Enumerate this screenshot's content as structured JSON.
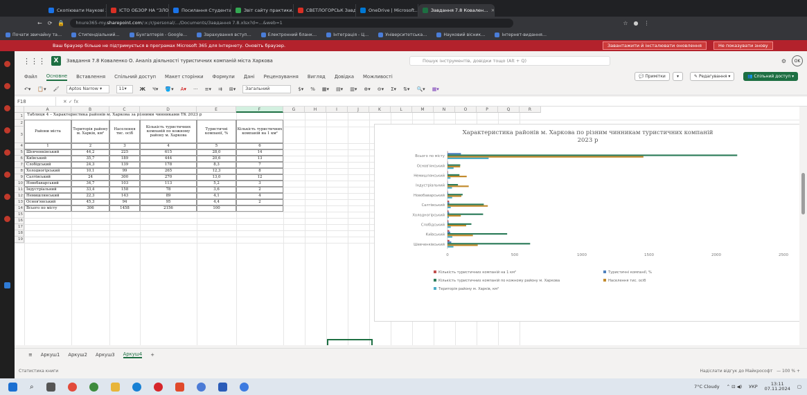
{
  "browser": {
    "tabs": [
      "Скопіювати Наукові 2…",
      "ІСТО ОБЗОР НА “ЗЛО…",
      "Посилання Студента",
      "Звіт сайту практики…",
      "СВЕТЛОГОРСЬК Завдання…",
      "OneDrive | Microsoft…",
      "Завдання 7.8 Ковален…"
    ],
    "url_prefix": "hnure365-my.",
    "url_host": "sharepoint.com",
    "url_rest": "/:x:/r/personal/.../Documents/Завдання 7.8.xlsx?d=...&web=1",
    "bookmarks": [
      "Почати звичайну та…",
      "Стипендіальний…",
      "Бухгалтерія - Google…",
      "Зарахування вступ…",
      "Електронний бланк…",
      "Інтеграція - Ц…",
      "Університетська…",
      "Науковий вісник…",
      "Інтернет-видання…"
    ],
    "banner_text": "Ваш браузер більше не підтримується в програмах Microsoft 365 для Інтернету. Оновіть браузер.",
    "banner_btn1": "Завантажити й інсталювати оновлення",
    "banner_btn2": "Не показувати знову"
  },
  "excel": {
    "file_title": "Завдання 7.8 Коваленко О. Аналіз діяльності туристичних компаній міста Харкова",
    "search_placeholder": "Пошук інструментів, довідки тощо (Alt + Q)",
    "ribbon_tabs": [
      "Файл",
      "Основне",
      "Вставлення",
      "Спільний доступ",
      "Макет сторінки",
      "Формули",
      "Дані",
      "Рецензування",
      "Вигляд",
      "Довідка",
      "Можливості"
    ],
    "ribbon_active": "Основне",
    "comments_btn": "Примітки",
    "editing_btn": "Редагування",
    "share_btn": "Спільний доступ",
    "font_name": "Aptos Narrow",
    "font_size": "11",
    "number_format": "Загальний",
    "name_box": "F18",
    "sheet_tabs": [
      "Аркуш1",
      "Аркуш2",
      "Аркуш3",
      "Аркуш4"
    ],
    "active_sheet": "Аркуш4",
    "add_sheet": "+",
    "status_left": "Статистика книги",
    "status_right": "Надіслати відгук до Майкрософт",
    "zoom": "100 %"
  },
  "columns": [
    "A",
    "B",
    "C",
    "D",
    "E",
    "F",
    "G",
    "H",
    "I",
    "J",
    "K",
    "L",
    "M",
    "N",
    "O",
    "P",
    "Q",
    "R"
  ],
  "row_numbers": [
    "1",
    "2",
    "3",
    "4",
    "5",
    "6",
    "7",
    "8",
    "9",
    "10",
    "11",
    "12",
    "13",
    "14",
    "15",
    "16",
    "17",
    "18",
    "19"
  ],
  "table": {
    "title": "Таблиця 4 – Характеристика районів м. Харкова за різними чинниками ТК 2023 р",
    "headers": [
      "Райони міста",
      "Територія району м. Харків, км²",
      "Населення тис. осіб",
      "Кількість туристичних компаній по кожному району м. Харкова",
      "Туристичні компанії, %",
      "Кількість туристичних компаній на 1 км²"
    ],
    "index_row": [
      "1",
      "2",
      "3",
      "4",
      "5",
      "6"
    ],
    "rows": [
      [
        "Шевченківський",
        "44,2",
        "225",
        "615",
        "28,0",
        "14"
      ],
      [
        "Київський",
        "35,7",
        "189",
        "444",
        "20,6",
        "13"
      ],
      [
        "Слобідський",
        "24,3",
        "139",
        "178",
        "8,3",
        "7"
      ],
      [
        "Холодногірський",
        "10,1",
        "99",
        "265",
        "12,3",
        "8"
      ],
      [
        "Салтівський",
        "24",
        "300",
        "270",
        "13,0",
        "12"
      ],
      [
        "Новобаварський",
        "34,7",
        "103",
        "113",
        "5,2",
        "3"
      ],
      [
        "Індустріальний",
        "33,4",
        "158",
        "78",
        "3,6",
        "2"
      ],
      [
        "Немишлянський",
        "22,3",
        "143",
        "89",
        "4,1",
        "4"
      ],
      [
        "Основ'янський",
        "45,3",
        "94",
        "95",
        "4,4",
        "2"
      ],
      [
        "Всього по місту",
        "306",
        "1458",
        "2156",
        "100",
        ""
      ]
    ]
  },
  "chart_data": {
    "type": "bar",
    "orientation": "horizontal",
    "title": "Характеристика районів м. Харкова по різним чинникам туристичних компаній 2023 р",
    "categories": [
      "Всього по місту",
      "Основ'янський",
      "Немишлянський",
      "Індустріальний",
      "Новобаварський",
      "Салтівський",
      "Холодногірський",
      "Слобідський",
      "Київський",
      "Шевченківський"
    ],
    "series": [
      {
        "name": "Кількість туристичних компаній на 1 км²",
        "color": "#c0504d",
        "values": [
          0,
          2,
          4,
          2,
          3,
          12,
          8,
          7,
          13,
          14
        ]
      },
      {
        "name": "Туристичні компанії, %",
        "color": "#4f81bd",
        "values": [
          100,
          4.4,
          4.1,
          3.6,
          5.2,
          13,
          12.3,
          8.3,
          20.6,
          28
        ]
      },
      {
        "name": "Кількість туристичних компаній по кожному району м. Харкова",
        "color": "#2e7d5b",
        "values": [
          2156,
          95,
          89,
          78,
          113,
          270,
          265,
          178,
          444,
          615
        ]
      },
      {
        "name": "Населення тис. осіб",
        "color": "#c28a2c",
        "values": [
          1458,
          94,
          143,
          158,
          103,
          300,
          99,
          139,
          189,
          225
        ]
      },
      {
        "name": "Територія району м. Харків, км²",
        "color": "#4bacc6",
        "values": [
          306,
          45.3,
          22.3,
          33.4,
          34.7,
          24,
          10.1,
          24.3,
          35.7,
          44.2
        ]
      }
    ],
    "xlim": [
      0,
      2500
    ],
    "xticks": [
      "0",
      "500",
      "1000",
      "1500",
      "2000",
      "2500"
    ],
    "legend": "bottom",
    "grid": false
  },
  "taskbar": {
    "weather": "7°C Cloudy",
    "lang": "УКР",
    "time": "13:11",
    "date": "07.11.2024"
  }
}
